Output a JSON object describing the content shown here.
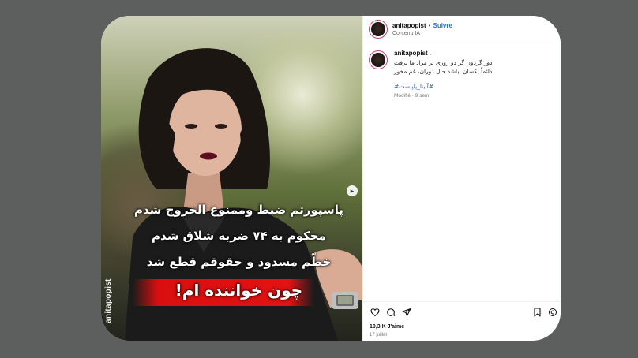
{
  "header": {
    "username": "anitapopist",
    "separator": "•",
    "follow_label": "Suivre",
    "subtext": "Contenu IA"
  },
  "caption": {
    "username": "anitapopist",
    "dot": ".",
    "lines": [
      "دور گردون گر دو روزی بر مراد ما نرفت",
      "دائماً یکسان نباشد حال دوران، غم مخور"
    ],
    "hashtag": "#آنیتا_پاپیست#",
    "meta": "Modifié · 9 sem"
  },
  "media": {
    "overlay_lines": [
      "پاسپورتم ضبط وممنوع الخروج شدم",
      "محکوم به ۷۴ ضربه شلاق شدم",
      "خطّم مسدود و حقوقم قطع شد"
    ],
    "overlay_highlight": "چون خواننده ام!",
    "watermark": "anitapopist",
    "highlight_color": "#e11313"
  },
  "actions": {
    "icons": [
      "heart-icon",
      "comment-icon",
      "share-icon",
      "bookmark-icon",
      "more-icon"
    ]
  },
  "likes": "10,3 K J'aime",
  "date": "17 juillet"
}
